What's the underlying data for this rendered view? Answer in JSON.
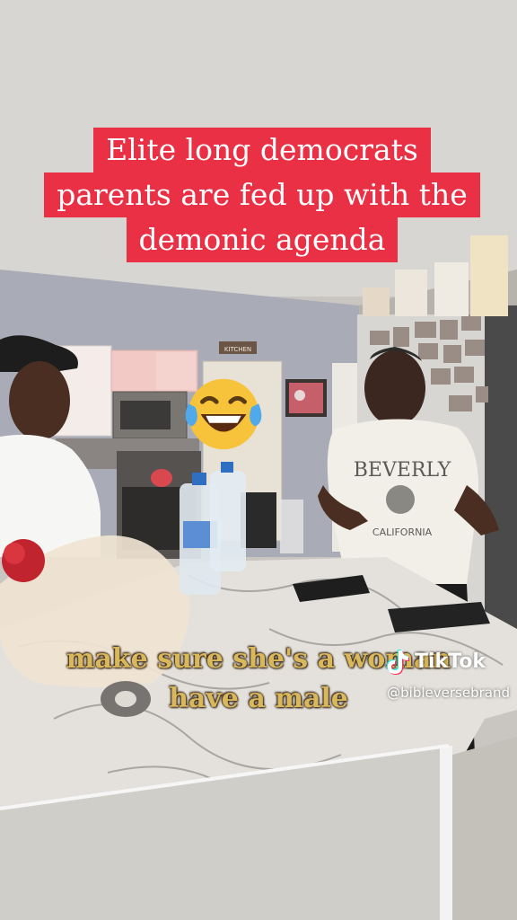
{
  "video": {
    "caption_top_lines": [
      "Elite long democrats",
      "parents are fed up with the",
      "demonic agenda"
    ],
    "caption_bottom_lines": [
      "make sure she's a woman",
      "have a male"
    ],
    "emoji": "laughing-with-tears-emoji"
  },
  "watermark": {
    "brand": "TikTok",
    "handle": "@bibleversebrand",
    "icon": "tiktok-logo-icon"
  },
  "scene": {
    "sign_text": "KITCHEN",
    "shirt_text_1": "BEVERLY",
    "shirt_text_2": "CALIFORNIA"
  },
  "colors": {
    "caption_banner": "#ea3045",
    "caption_text": "#ffffff",
    "bottom_caption": "#d9b75b"
  }
}
